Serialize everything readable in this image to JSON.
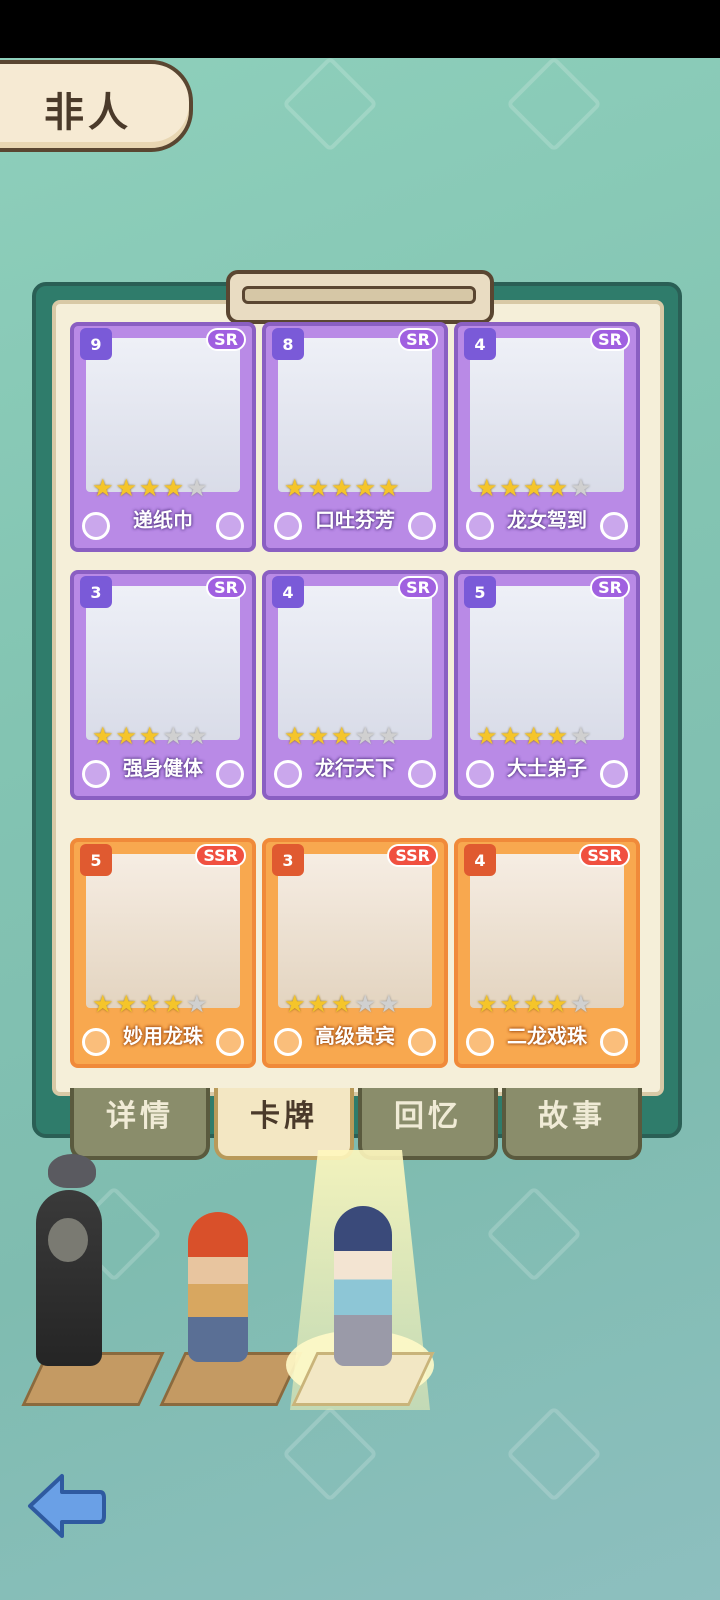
{
  "category_title": "非人",
  "cards": [
    {
      "name": "递纸巾",
      "number": "9",
      "rarity": "SR",
      "stars": 4
    },
    {
      "name": "口吐芬芳",
      "number": "8",
      "rarity": "SR",
      "stars": 5
    },
    {
      "name": "龙女驾到",
      "number": "4",
      "rarity": "SR",
      "stars": 4
    },
    {
      "name": "强身健体",
      "number": "3",
      "rarity": "SR",
      "stars": 3
    },
    {
      "name": "龙行天下",
      "number": "4",
      "rarity": "SR",
      "stars": 3
    },
    {
      "name": "大士弟子",
      "number": "5",
      "rarity": "SR",
      "stars": 4
    },
    {
      "name": "妙用龙珠",
      "number": "5",
      "rarity": "SSR",
      "stars": 4
    },
    {
      "name": "高级贵宾",
      "number": "3",
      "rarity": "SSR",
      "stars": 3
    },
    {
      "name": "二龙戏珠",
      "number": "4",
      "rarity": "SSR",
      "stars": 4
    }
  ],
  "tabs": [
    {
      "label": "详情",
      "active": false
    },
    {
      "label": "卡牌",
      "active": true
    },
    {
      "label": "回忆",
      "active": false
    },
    {
      "label": "故事",
      "active": false
    }
  ],
  "characters": [
    {
      "name": "hooded-character",
      "selected": false
    },
    {
      "name": "red-hair-character",
      "selected": false
    },
    {
      "name": "dragon-girl-character",
      "selected": true
    }
  ],
  "icons": {
    "back": "back-arrow-icon"
  },
  "colors": {
    "sr_frame": "#8a5fc2",
    "ssr_frame": "#f08a3a",
    "board": "#2f7c6b",
    "star_on": "#f5c52a"
  }
}
